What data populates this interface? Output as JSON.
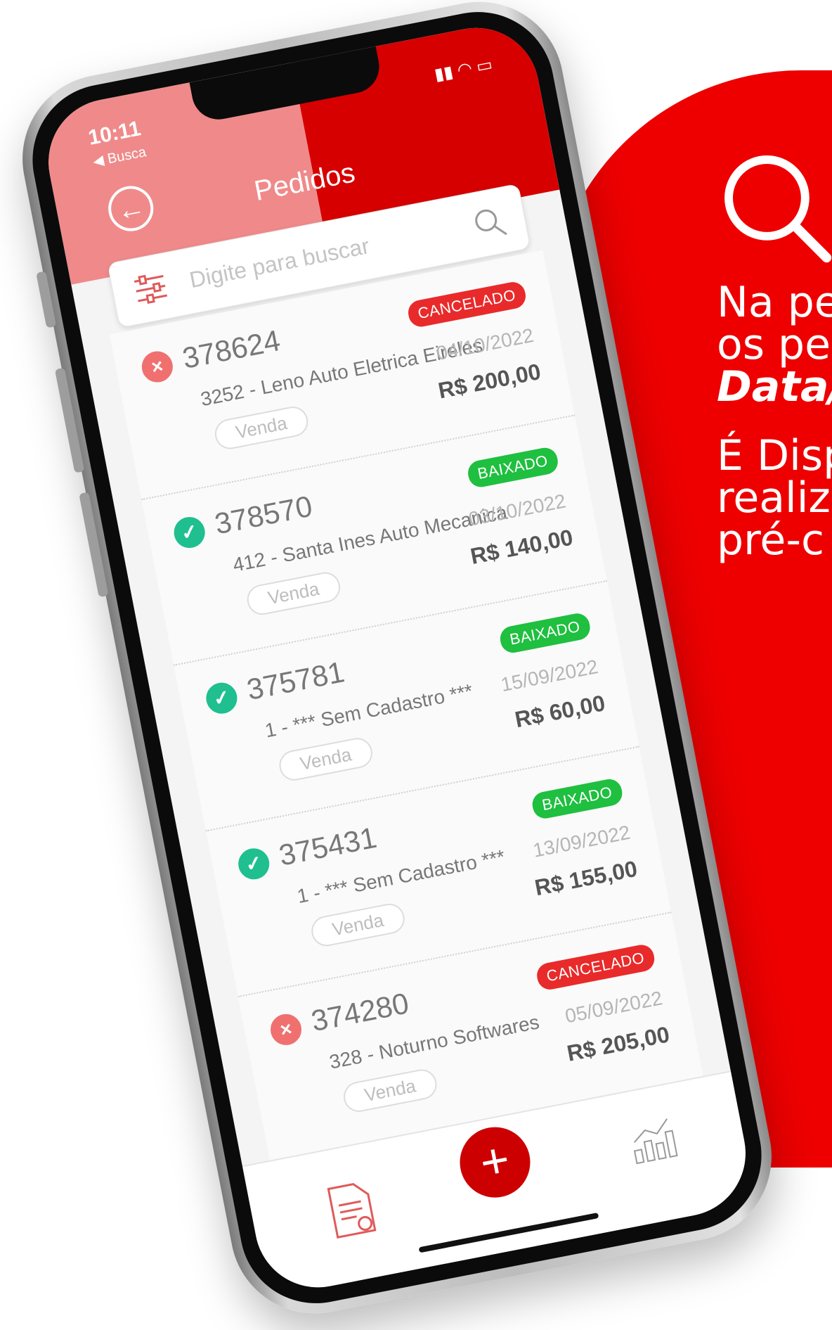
{
  "promo": {
    "line1": "Na pe",
    "line2": "os pe",
    "line3": "Data/",
    "line4": "É Disp",
    "line5": "realiz",
    "line6": "pré-c"
  },
  "status_bar": {
    "time": "10:11",
    "back_label": "◀ Busca"
  },
  "header": {
    "title": "Pedidos"
  },
  "search": {
    "placeholder": "Digite para buscar"
  },
  "orders": [
    {
      "id": "378624",
      "client": "3252 - Leno Auto Eletrica Eireles",
      "type": "Venda",
      "status": "CANCELADO",
      "date": "04/10/2022",
      "total": "R$ 200,00"
    },
    {
      "id": "378570",
      "client": "412 - Santa Ines Auto Mecanica",
      "type": "Venda",
      "status": "BAIXADO",
      "date": "03/10/2022",
      "total": "R$ 140,00"
    },
    {
      "id": "375781",
      "client": "1 - *** Sem Cadastro ***",
      "type": "Venda",
      "status": "BAIXADO",
      "date": "15/09/2022",
      "total": "R$ 60,00"
    },
    {
      "id": "375431",
      "client": "1 - *** Sem Cadastro ***",
      "type": "Venda",
      "status": "BAIXADO",
      "date": "13/09/2022",
      "total": "R$ 155,00"
    },
    {
      "id": "374280",
      "client": "328 - Noturno Softwares",
      "type": "Venda",
      "status": "CANCELADO",
      "date": "05/09/2022",
      "total": "R$ 205,00"
    }
  ],
  "colors": {
    "brand_red": "#d60000",
    "status_ok": "#1fbf3f",
    "status_cancel": "#e92a2a"
  },
  "icons": {
    "back": "arrow-left-circle-icon",
    "filter": "sliders-icon",
    "search": "search-icon",
    "add": "plus-icon",
    "reports": "document-icon",
    "stats": "bar-chart-icon"
  }
}
